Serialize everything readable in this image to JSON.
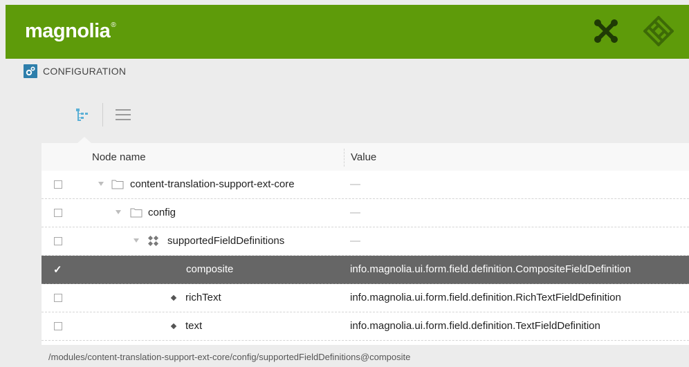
{
  "header": {
    "logo_text": "magnolia",
    "logo_mark": "®",
    "brand_color": "#5e9b0a",
    "right_icons": [
      "pulse-x-icon",
      "app-launcher-icon"
    ]
  },
  "app": {
    "icon": "configuration-gear-icon",
    "title": "CONFIGURATION"
  },
  "view_toggle": {
    "active": "tree-view",
    "options": [
      "tree-view-icon",
      "list-view-icon"
    ]
  },
  "grid": {
    "columns": {
      "name": "Node name",
      "value": "Value"
    },
    "rows": [
      {
        "name": "content-translation-support-ext-core",
        "value": "—",
        "type": "folder",
        "checked": false,
        "selected": false
      },
      {
        "name": "config",
        "value": "—",
        "type": "folder",
        "checked": false,
        "selected": false
      },
      {
        "name": "supportedFieldDefinitions",
        "value": "—",
        "type": "content-node",
        "checked": false,
        "selected": false
      },
      {
        "name": "composite",
        "value": "info.magnolia.ui.form.field.definition.CompositeFieldDefinition",
        "type": "property",
        "checked": true,
        "selected": true
      },
      {
        "name": "richText",
        "value": "info.magnolia.ui.form.field.definition.RichTextFieldDefinition",
        "type": "property",
        "checked": false,
        "selected": false
      },
      {
        "name": "text",
        "value": "info.magnolia.ui.form.field.definition.TextFieldDefinition",
        "type": "property",
        "checked": false,
        "selected": false
      }
    ]
  },
  "status": {
    "path": "/modules/content-translation-support-ext-core/config/supportedFieldDefinitions@composite"
  }
}
